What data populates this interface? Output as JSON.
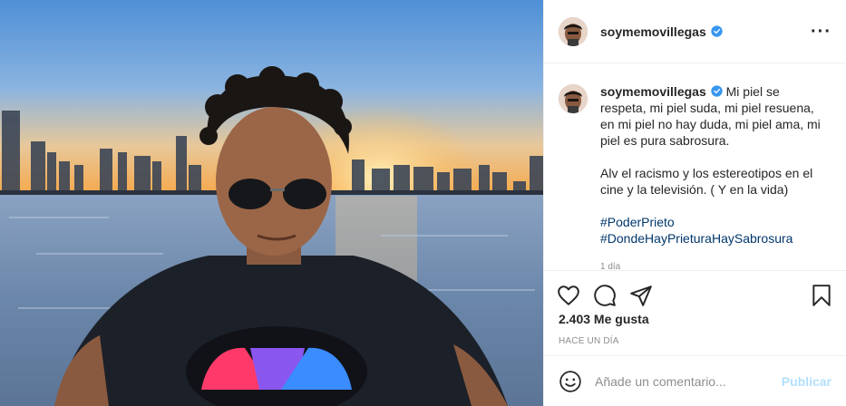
{
  "post": {
    "photo_alt": "",
    "author": {
      "username": "soymemovillegas",
      "verified": true
    },
    "more_icon": "more-options-icon",
    "caption": {
      "username": "soymemovillegas",
      "line1": "Mi piel se respeta, mi piel suda, mi piel resuena, en mi piel no hay duda, mi piel ama, mi piel es pura sabrosura.",
      "line2": "Alv el racismo y los estereotipos en el cine y la televisión. ( Y en la vida)",
      "hashtags": [
        "#PoderPrieto",
        "#DondeHayPrieturaHaySabrosura"
      ],
      "time_partial": "1 día"
    },
    "actions": {
      "icons": [
        "heart-icon",
        "comment-icon",
        "share-icon",
        "bookmark-icon"
      ]
    },
    "likes": "2.403 Me gusta",
    "time_ago": "HACE UN DÍA",
    "comment_box": {
      "placeholder": "Añade un comentario...",
      "publish_label": "Publicar",
      "emoji_icon": "emoji-icon"
    },
    "colors": {
      "link": "#00376b",
      "verified": "#3897f0",
      "publish_disabled": "#b2dffc",
      "muted": "#8e8e8e"
    }
  }
}
